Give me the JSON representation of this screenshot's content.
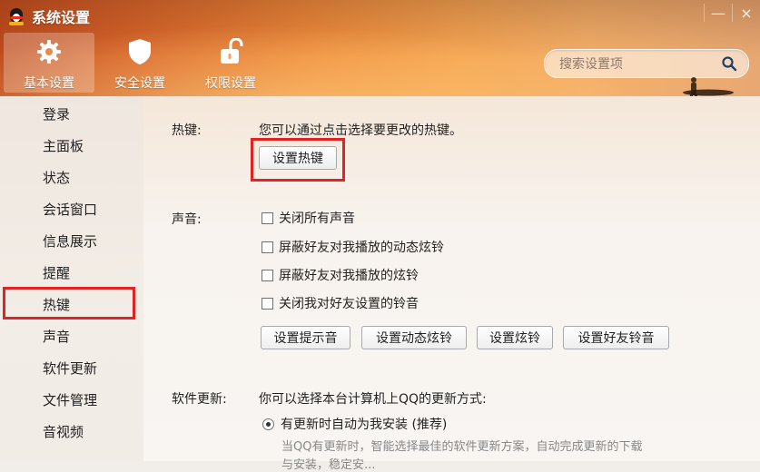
{
  "window": {
    "title": "系统设置",
    "minimize_glyph": "—",
    "close_glyph": "×"
  },
  "tabs": [
    {
      "label": "基本设置",
      "icon": "gear-icon",
      "active": true
    },
    {
      "label": "安全设置",
      "icon": "shield-icon",
      "active": false
    },
    {
      "label": "权限设置",
      "icon": "unlock-icon",
      "active": false
    }
  ],
  "search": {
    "placeholder": "搜索设置项",
    "icon": "search-icon"
  },
  "sidebar": {
    "items": [
      {
        "label": "登录"
      },
      {
        "label": "主面板"
      },
      {
        "label": "状态"
      },
      {
        "label": "会话窗口"
      },
      {
        "label": "信息展示"
      },
      {
        "label": "提醒"
      },
      {
        "label": "热键",
        "selected": true
      },
      {
        "label": "声音"
      },
      {
        "label": "软件更新"
      },
      {
        "label": "文件管理"
      },
      {
        "label": "音视频"
      }
    ]
  },
  "hotkey": {
    "label": "热键:",
    "description": "您可以通过点击选择要更改的热键。",
    "button": "设置热键"
  },
  "sound": {
    "label": "声音:",
    "options": [
      {
        "label": "关闭所有声音",
        "checked": false
      },
      {
        "label": "屏蔽好友对我播放的动态炫铃",
        "checked": false
      },
      {
        "label": "屏蔽好友对我播放的炫铃",
        "checked": false
      },
      {
        "label": "关闭我对好友设置的铃音",
        "checked": false
      }
    ],
    "buttons": [
      "设置提示音",
      "设置动态炫铃",
      "设置炫铃",
      "设置好友铃音"
    ]
  },
  "update": {
    "label": "软件更新:",
    "description": "你可以选择本台计算机上QQ的更新方式:",
    "radio_label": "有更新时自动为我安装 (推荐)",
    "note": "当QQ有更新时，智能选择最佳的软件更新方案，自动完成更新的下载",
    "note2": "与安装，稳定安..."
  },
  "colors": {
    "accent": "#e02424",
    "header_start": "#c14b1b",
    "header_end": "#f4b06a"
  }
}
